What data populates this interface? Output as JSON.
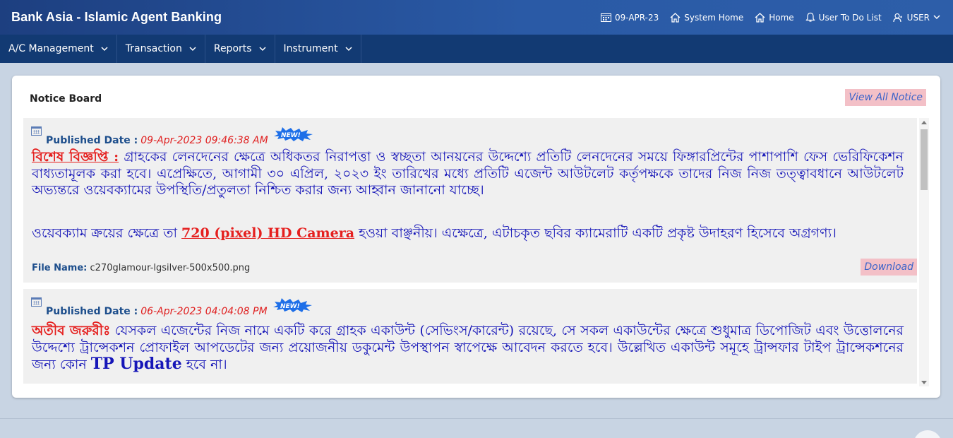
{
  "header": {
    "brand": "Bank Asia - Islamic Agent Banking",
    "date": "09-APR-23",
    "system_home": "System Home",
    "home": "Home",
    "todo": "User To Do List",
    "user": "USER"
  },
  "menu": {
    "items": [
      {
        "label": "A/C Management"
      },
      {
        "label": "Transaction"
      },
      {
        "label": "Reports"
      },
      {
        "label": "Instrument"
      }
    ]
  },
  "notice_board": {
    "title": "Notice Board",
    "view_all": "View All Notice",
    "published_label": "Published Date :",
    "new_badge": "NEW!",
    "notices": [
      {
        "date": "09-Apr-2023 09:46:38 AM",
        "heading": "বিশেষ বিজ্ঞপ্তি :",
        "para1": " গ্রাহকের লেনদেনের ক্ষেত্রে অধিকতর নিরাপত্তা ও স্বচ্ছতা আনয়নের উদ্দেশ্যে  প্রতিটি লেনদেনের সময়ে ফিঙ্গারপ্রিন্টের পাশাপাশি ফেস ভেরিফিকেশন বাধ্যতামূলক করা হবে। এপ্রেক্ষিতে, আগামী ৩০ এপ্রিল, ২০২৩ ইং তারিখের মধ্যে প্রতিটি এজেন্ট আউটলেট কর্তৃপক্ষকে তাদের নিজ নিজ তত্ত্বাবধানে আউটলেট অভ্যন্তরে ওয়েবক্যামের উপস্থিতি/প্রতুলতা নিশ্চিত করার জন্য আহ্বান জানানো যাচ্ছে।",
        "para2_pre": "ওয়েবক্যাম ক্রয়ের ক্ষেত্রে তা ",
        "para2_highlight": "720 (pixel) HD Camera",
        "para2_post": " হওয়া বাঞ্ছনীয়। এক্ষেত্রে, এটাচকৃত ছবির ক্যামেরাটি একটি প্রকৃষ্ট উদাহরণ হিসেবে অগ্রগণ্য।",
        "file_label": "File Name:",
        "file_name": "c270glamour-lgsilver-500x500.png",
        "download": "Download"
      },
      {
        "date": "06-Apr-2023 04:04:08 PM",
        "heading": "অতীব জরুরীঃ",
        "para1": " যেসকল এজেন্টের নিজ নামে একটি করে গ্রাহক একাউন্ট (সেভিংস/কারেন্ট) রয়েছে, সে সকল একাউন্টের ক্ষেত্রে শুধুমাত্র ডিপোজিট এবং উত্তোলনের উদ্দেশ্যে ট্রান্সেকশন প্রোফাইল আপডেটের জন্য প্রয়োজনীয় ডকুমেন্ট উপস্থাপন স্বাপেক্ষে আবেদন করতে হবে। উল্লেখিত একাউন্ট সমূহে ট্রান্সফার টাইপ ট্রান্সেকশনের জন্য কোন ",
        "para1_tp": "TP Update",
        "para1_end": " হবে না।"
      }
    ]
  }
}
